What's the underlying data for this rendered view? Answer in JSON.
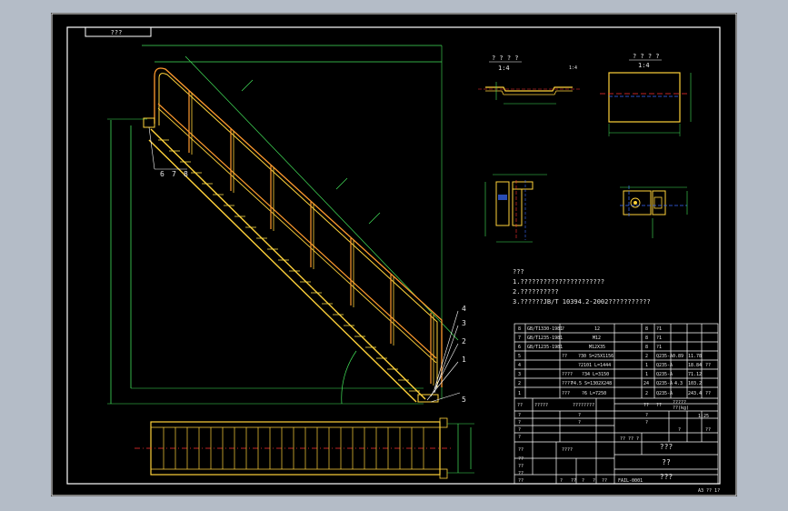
{
  "title_block_top": "???",
  "views": {
    "detail_a_label": "? ? ? ?",
    "detail_a_scale": "1:4",
    "detail_b_label": "? ? ? ?",
    "detail_b_scale": "1:4",
    "section_label": "1:4"
  },
  "callouts": {
    "left": [
      "6",
      "7",
      "8"
    ],
    "right": [
      "4",
      "3",
      "2",
      "1"
    ],
    "bottom": "5"
  },
  "notes": {
    "heading": "???",
    "lines": [
      "1.??????????????????????",
      "2.??????????",
      "3.??????JB/T 10394.2-2002???????????"
    ]
  },
  "bom": {
    "rows": [
      {
        "no": "8",
        "code": "GB/T1330-1981",
        "name": "?",
        "spec": "12",
        "qty": "8",
        "mat": "?1",
        "unit": "",
        "total": "",
        "note": ""
      },
      {
        "no": "7",
        "code": "GB/T1235-1981",
        "name": "",
        "spec": "M12",
        "qty": "8",
        "mat": "?1",
        "unit": "",
        "total": "",
        "note": ""
      },
      {
        "no": "6",
        "code": "GB/T1235-1981",
        "name": "",
        "spec": "M12X35",
        "qty": "8",
        "mat": "?1",
        "unit": "",
        "total": "",
        "note": ""
      },
      {
        "no": "5",
        "code": "",
        "name": "??",
        "spec": "?30 S=25X1156",
        "qty": "2",
        "mat": "Q235-A",
        "unit": "0.89",
        "total": "11.78",
        "note": ""
      },
      {
        "no": "4",
        "code": "",
        "name": "",
        "spec": "?2101 L=1444",
        "qty": "1",
        "mat": "Q235-A",
        "unit": "",
        "total": "18.84",
        "note": "??"
      },
      {
        "no": "3",
        "code": "",
        "name": "????",
        "spec": "?34 L=3150",
        "qty": "1",
        "mat": "Q235-A",
        "unit": "",
        "total": "71.12",
        "note": ""
      },
      {
        "no": "2",
        "code": "",
        "name": "????",
        "spec": "?4.5 S=1302X248",
        "qty": "24",
        "mat": "Q235-A",
        "unit": "4.3",
        "total": "103.2",
        "note": ""
      },
      {
        "no": "1",
        "code": "",
        "name": "???",
        "spec": "?6 L=7250",
        "qty": "2",
        "mat": "Q235-A",
        "unit": "",
        "total": "243.4",
        "note": "??"
      }
    ],
    "header": {
      "c1": "??",
      "c2": "?????",
      "c3": "????????",
      "c4": "??",
      "c5": "??",
      "c6": "?????",
      "c7": "??(kg)"
    }
  },
  "title_block": {
    "drawing_name": "??",
    "org": "???",
    "scale": "1:25",
    "sheets": "?? ?? ?",
    "code_small": "????",
    "stamp": "???",
    "rev_rows": [
      "?",
      "?",
      "?",
      "?"
    ],
    "sign_labels": [
      "??",
      "??",
      "??",
      "??",
      "??"
    ],
    "footer": [
      "?",
      "??",
      "?",
      "?",
      "??",
      "FAIL-0001"
    ],
    "vals": [
      "?",
      "?",
      "?",
      "?",
      "?",
      "??"
    ]
  },
  "sheet_tag": "A3 ?? 1?"
}
